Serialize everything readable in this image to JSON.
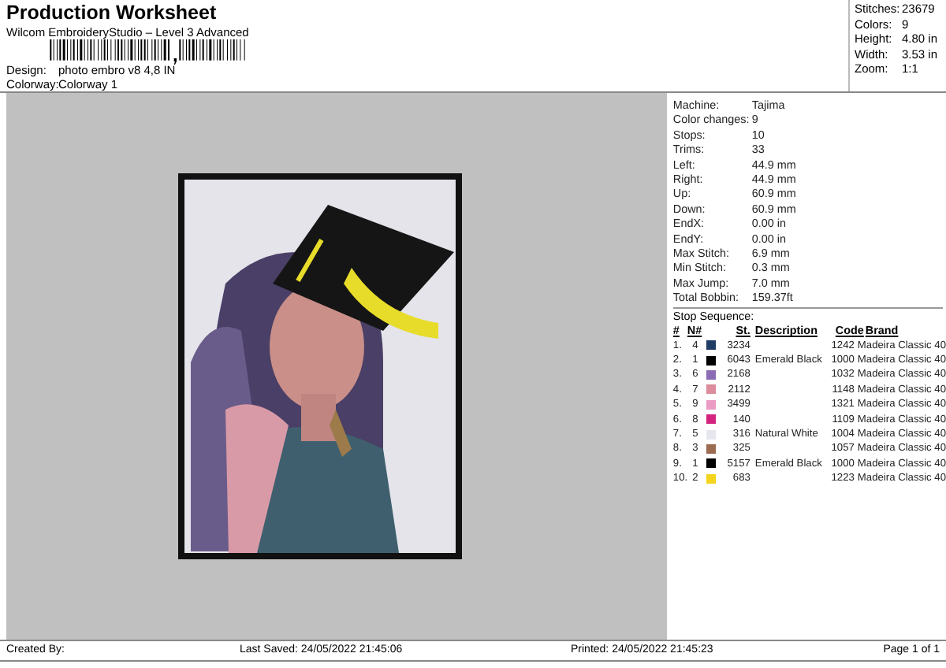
{
  "header": {
    "title": "Production Worksheet",
    "subtitle": "Wilcom EmbroideryStudio – Level 3 Advanced",
    "fields": [
      {
        "label": "Design:",
        "value": "photo embro v8 4,8 IN"
      },
      {
        "label": "Colorway:",
        "value": "Colorway 1"
      }
    ]
  },
  "summary": [
    {
      "label": "Stitches:",
      "value": "23679"
    },
    {
      "label": "Colors:",
      "value": "9"
    },
    {
      "label": "Height:",
      "value": "4.80 in"
    },
    {
      "label": "Width:",
      "value": "3.53 in"
    },
    {
      "label": "Zoom:",
      "value": "1:1"
    }
  ],
  "details": [
    {
      "label": "Machine:",
      "value": "Tajima"
    },
    {
      "label": "Color changes:",
      "value": "9"
    },
    {
      "label": "Stops:",
      "value": "10"
    },
    {
      "label": "Trims:",
      "value": "33"
    },
    {
      "label": "Left:",
      "value": "44.9 mm"
    },
    {
      "label": "Right:",
      "value": "44.9 mm"
    },
    {
      "label": "Up:",
      "value": "60.9 mm"
    },
    {
      "label": "Down:",
      "value": "60.9 mm"
    },
    {
      "label": "EndX:",
      "value": "0.00 in"
    },
    {
      "label": "EndY:",
      "value": "0.00 in"
    },
    {
      "label": "Max Stitch:",
      "value": "6.9 mm"
    },
    {
      "label": "Min Stitch:",
      "value": "0.3 mm"
    },
    {
      "label": "Max Jump:",
      "value": "7.0 mm"
    },
    {
      "label": "Total Bobbin:",
      "value": "159.37ft"
    }
  ],
  "stop_sequence": {
    "title": "Stop Sequence:",
    "columns": [
      "#",
      "N#",
      "St.",
      "Description",
      "Code",
      "Brand"
    ],
    "rows": [
      {
        "index": "1.",
        "needle": "4",
        "color": "#1f3d64",
        "st": "3234",
        "description": "",
        "code": "1242",
        "brand": "Madeira Classic 40"
      },
      {
        "index": "2.",
        "needle": "1",
        "color": "#000000",
        "st": "6043",
        "description": "Emerald Black",
        "code": "1000",
        "brand": "Madeira Classic 40"
      },
      {
        "index": "3.",
        "needle": "6",
        "color": "#8c6cb4",
        "st": "2168",
        "description": "",
        "code": "1032",
        "brand": "Madeira Classic 40"
      },
      {
        "index": "4.",
        "needle": "7",
        "color": "#dc8c9c",
        "st": "2112",
        "description": "",
        "code": "1148",
        "brand": "Madeira Classic 40"
      },
      {
        "index": "5.",
        "needle": "9",
        "color": "#ec9cc4",
        "st": "3499",
        "description": "",
        "code": "1321",
        "brand": "Madeira Classic 40"
      },
      {
        "index": "6.",
        "needle": "8",
        "color": "#d42480",
        "st": "140",
        "description": "",
        "code": "1109",
        "brand": "Madeira Classic 40"
      },
      {
        "index": "7.",
        "needle": "5",
        "color": "#e6e6ee",
        "st": "316",
        "description": "Natural White",
        "code": "1004",
        "brand": "Madeira Classic 40"
      },
      {
        "index": "8.",
        "needle": "3",
        "color": "#9c6c50",
        "st": "325",
        "description": "",
        "code": "1057",
        "brand": "Madeira Classic 40"
      },
      {
        "index": "9.",
        "needle": "1",
        "color": "#000000",
        "st": "5157",
        "description": "Emerald Black",
        "code": "1000",
        "brand": "Madeira Classic 40"
      },
      {
        "index": "10.",
        "needle": "2",
        "color": "#f4d41c",
        "st": "683",
        "description": "",
        "code": "1223",
        "brand": "Madeira Classic 40"
      }
    ]
  },
  "footer": {
    "created_by": "Created By:",
    "last_saved": "Last Saved: 24/05/2022 21:45:06",
    "printed": "Printed: 24/05/2022 21:45:23",
    "page": "Page 1 of 1"
  }
}
